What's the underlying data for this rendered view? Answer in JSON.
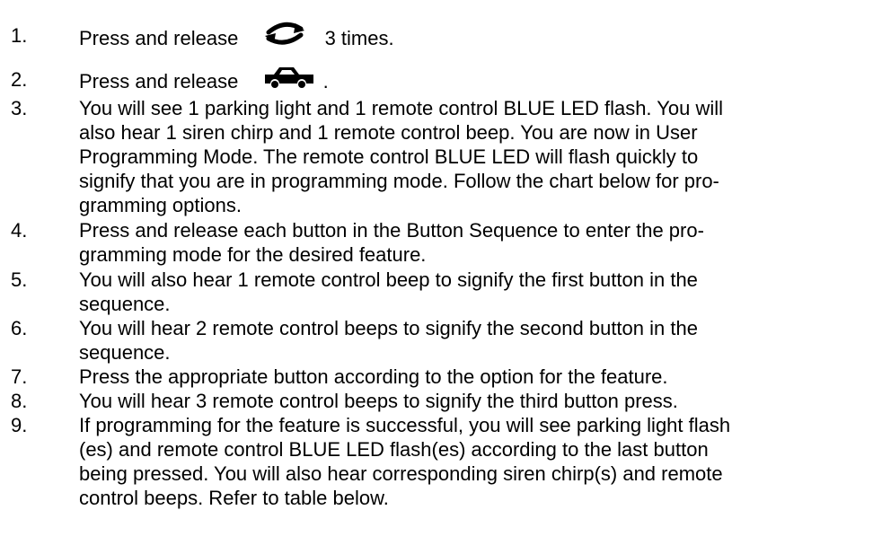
{
  "steps": [
    {
      "number": "1.",
      "before_icon": "Press and release",
      "icon": "cycle-arrows-icon",
      "after_icon": "3 times."
    },
    {
      "number": "2.",
      "before_icon": "Press and release",
      "icon": "car-trunk-icon",
      "after_icon": "."
    },
    {
      "number": "3.",
      "lines": [
        "You will see 1 parking light and 1 remote control BLUE LED flash.  You will",
        "also hear 1 siren chirp and 1 remote control beep.  You are now in User",
        "Programming Mode.  The remote control BLUE LED will flash quickly to",
        "signify that you are in programming mode.  Follow the chart below for pro-",
        "gramming options."
      ]
    },
    {
      "number": "4.",
      "lines": [
        "Press and release each button in the Button Sequence to enter the pro-",
        "gramming mode for the desired feature."
      ]
    },
    {
      "number": "5.",
      "lines": [
        "You will also hear 1 remote control beep to signify the first button in the",
        "sequence."
      ]
    },
    {
      "number": "6.",
      "lines": [
        "You will hear 2 remote control beeps to signify the second button in the",
        "sequence."
      ]
    },
    {
      "number": "7.",
      "lines": [
        "Press the appropriate  button according to the option for the feature."
      ]
    },
    {
      "number": "8.",
      "lines": [
        "You will hear 3 remote control beeps to signify the third button press."
      ]
    },
    {
      "number": "9.",
      "lines": [
        "If programming for the feature is successful, you will see parking light flash",
        "(es) and remote control BLUE LED flash(es) according to the last button",
        "being pressed.  You will also hear corresponding siren chirp(s) and remote",
        "control beeps.  Refer to table below."
      ]
    }
  ]
}
